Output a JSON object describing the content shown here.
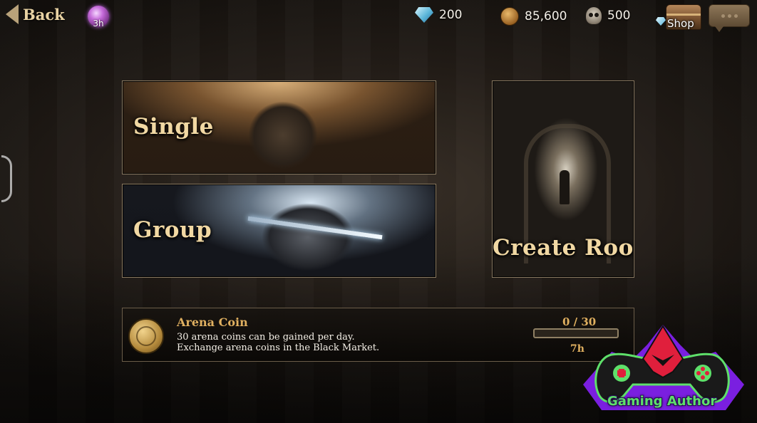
{
  "header": {
    "back_label": "Back",
    "timer_badge": "3h",
    "currencies": [
      {
        "icon": "diamond-icon",
        "value": "200"
      },
      {
        "icon": "coin-icon",
        "value": "85,600"
      },
      {
        "icon": "skull-icon",
        "value": "500"
      }
    ],
    "shop_label": "Shop"
  },
  "modes": {
    "single_label": "Single",
    "group_label": "Group",
    "create_room_label": "Create Room"
  },
  "arena_coin": {
    "title": "Arena Coin",
    "line1": "30 arena coins can be gained per day.",
    "line2": "Exchange arena coins in the Black Market.",
    "count": "0 / 30",
    "progress": 0,
    "timer": "7h"
  },
  "watermark": {
    "text": "Gaming Author"
  },
  "colors": {
    "accent_gold": "#e0b060",
    "label_cream": "#f1d8a3",
    "logo_green": "#5ee06a",
    "logo_purple": "#7a1fe0",
    "logo_red": "#e01f3c"
  }
}
